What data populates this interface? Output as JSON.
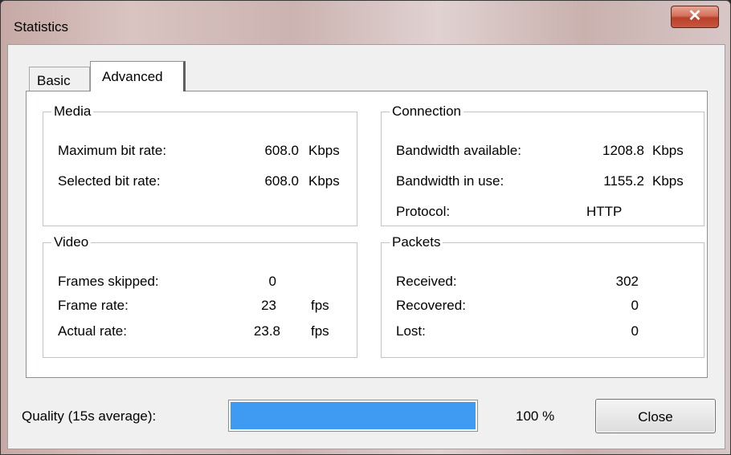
{
  "window": {
    "title": "Statistics",
    "close_glyph": "✕"
  },
  "tabs": [
    {
      "label": "Basic"
    },
    {
      "label": "Advanced"
    }
  ],
  "media": {
    "title": "Media",
    "rows": [
      {
        "label": "Maximum bit rate:",
        "value": "608.0",
        "unit": "Kbps"
      },
      {
        "label": "Selected bit rate:",
        "value": "608.0",
        "unit": "Kbps"
      }
    ]
  },
  "connection": {
    "title": "Connection",
    "rows": [
      {
        "label": "Bandwidth available:",
        "value": "1208.8",
        "unit": "Kbps"
      },
      {
        "label": "Bandwidth in use:",
        "value": "1155.2",
        "unit": "Kbps"
      },
      {
        "label": "Protocol:",
        "value": "HTTP",
        "unit": ""
      }
    ]
  },
  "video": {
    "title": "Video",
    "rows": [
      {
        "label": "Frames skipped:",
        "value": "0",
        "unit": ""
      },
      {
        "label": "Frame rate:",
        "value": "23",
        "unit": "fps"
      },
      {
        "label": "Actual rate:",
        "value": "23.8",
        "unit": "fps"
      }
    ]
  },
  "packets": {
    "title": "Packets",
    "rows": [
      {
        "label": "Received:",
        "value": "302"
      },
      {
        "label": "Recovered:",
        "value": "0"
      },
      {
        "label": "Lost:",
        "value": "0"
      }
    ]
  },
  "quality": {
    "label": "Quality (15s average):",
    "percent_text": "100 %",
    "level": 100
  },
  "buttons": {
    "close_label": "Close"
  },
  "colors": {
    "progress_fill": "#3f9bf2",
    "title_close_red": "#c9573f"
  },
  "icons": {
    "title_close": "close-icon"
  }
}
